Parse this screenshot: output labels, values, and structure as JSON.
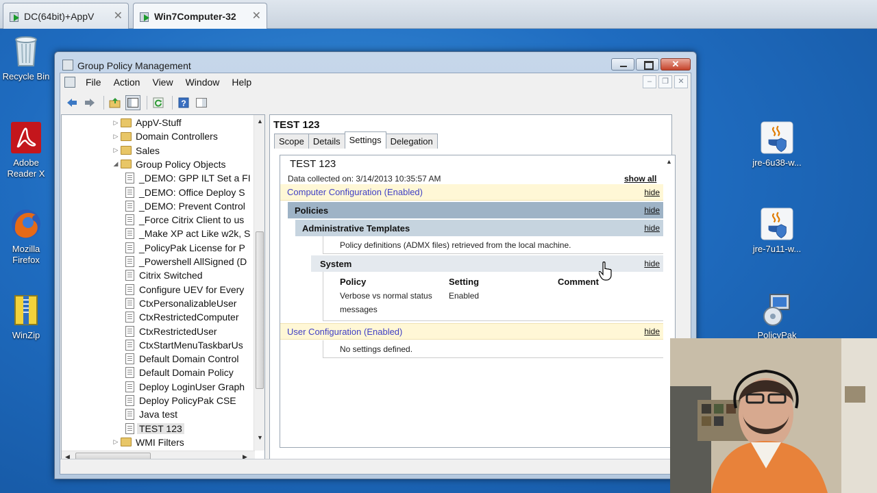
{
  "vm_tabs": [
    {
      "label": "DC(64bit)+AppV",
      "active": false
    },
    {
      "label": "Win7Computer-32",
      "active": true
    }
  ],
  "desktop_icons": [
    {
      "label": "Recycle Bin",
      "icon": "recycle-bin-icon"
    },
    {
      "label": "Adobe Reader X",
      "icon": "adobe-reader-icon"
    },
    {
      "label": "Mozilla Firefox",
      "icon": "firefox-icon"
    },
    {
      "label": "WinZip",
      "icon": "winzip-icon"
    },
    {
      "label": "jre-6u38-w...",
      "icon": "java-installer-icon"
    },
    {
      "label": "jre-7u11-w...",
      "icon": "java-installer-icon"
    },
    {
      "label": "PolicyPak",
      "icon": "policypak-installer-icon"
    }
  ],
  "window": {
    "title": "Group Policy Management",
    "menu": [
      "File",
      "Action",
      "View",
      "Window",
      "Help"
    ]
  },
  "tree": {
    "items": [
      {
        "label": "AppV-Stuff",
        "type": "folder",
        "indent": 1,
        "expander": "▷"
      },
      {
        "label": "Domain Controllers",
        "type": "folder",
        "indent": 1,
        "expander": "▷"
      },
      {
        "label": "Sales",
        "type": "folder",
        "indent": 1,
        "expander": "▷"
      },
      {
        "label": "Group Policy Objects",
        "type": "folder",
        "indent": 1,
        "expander": "◢"
      },
      {
        "label": "_DEMO: GPP ILT Set a FI",
        "type": "gpo",
        "indent": 2
      },
      {
        "label": "_DEMO: Office Deploy S",
        "type": "gpo",
        "indent": 2
      },
      {
        "label": "_DEMO: Prevent Control",
        "type": "gpo",
        "indent": 2
      },
      {
        "label": "_Force Citrix Client to us",
        "type": "gpo",
        "indent": 2
      },
      {
        "label": "_Make XP act Like w2k, S",
        "type": "gpo",
        "indent": 2
      },
      {
        "label": "_PolicyPak License for P",
        "type": "gpo",
        "indent": 2
      },
      {
        "label": "_Powershell AllSigned (D",
        "type": "gpo",
        "indent": 2
      },
      {
        "label": "Citrix Switched",
        "type": "gpo",
        "indent": 2
      },
      {
        "label": "Configure UEV for Every",
        "type": "gpo",
        "indent": 2
      },
      {
        "label": "CtxPersonalizableUser",
        "type": "gpo",
        "indent": 2
      },
      {
        "label": "CtxRestrictedComputer",
        "type": "gpo",
        "indent": 2
      },
      {
        "label": "CtxRestrictedUser",
        "type": "gpo",
        "indent": 2
      },
      {
        "label": "CtxStartMenuTaskbarUs",
        "type": "gpo",
        "indent": 2
      },
      {
        "label": "Default Domain Control",
        "type": "gpo",
        "indent": 2
      },
      {
        "label": "Default Domain Policy",
        "type": "gpo",
        "indent": 2
      },
      {
        "label": "Deploy LoginUser Graph",
        "type": "gpo",
        "indent": 2
      },
      {
        "label": "Deploy PolicyPak CSE",
        "type": "gpo",
        "indent": 2
      },
      {
        "label": "Java test",
        "type": "gpo",
        "indent": 2
      },
      {
        "label": "TEST 123",
        "type": "gpo",
        "indent": 2,
        "selected": true
      },
      {
        "label": "WMI Filters",
        "type": "folder",
        "indent": 1,
        "expander": "▷"
      }
    ]
  },
  "details": {
    "title": "TEST 123",
    "tabs": [
      "Scope",
      "Details",
      "Settings",
      "Delegation"
    ],
    "active_tab": "Settings",
    "report": {
      "title": "TEST 123",
      "collected": "Data collected on: 3/14/2013 10:35:57 AM",
      "show_all": "show all",
      "hide": "hide",
      "computer_config": "Computer Configuration (Enabled)",
      "policies": "Policies",
      "admin_templates": "Administrative Templates",
      "admx_note": "Policy definitions (ADMX files) retrieved from the local machine.",
      "system": "System",
      "col_policy": "Policy",
      "col_setting": "Setting",
      "col_comment": "Comment",
      "row_policy_line1": "Verbose vs normal status",
      "row_policy_line2": "messages",
      "row_setting": "Enabled",
      "user_config": "User Configuration (Enabled)",
      "no_settings": "No settings defined."
    }
  }
}
